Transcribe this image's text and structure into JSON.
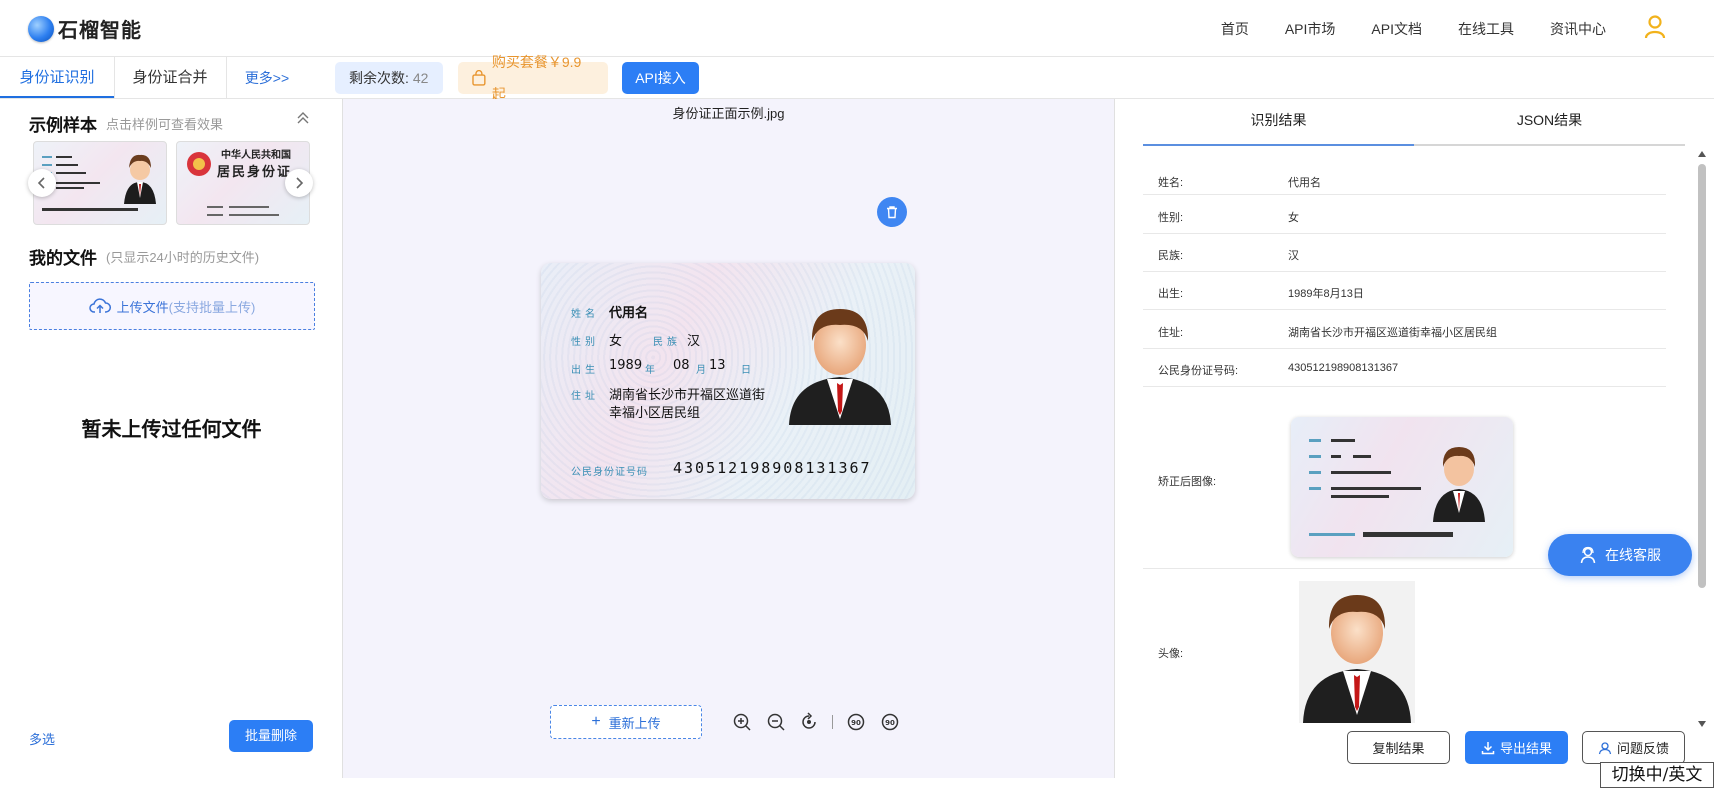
{
  "header": {
    "logo_text": "石榴智能",
    "nav": [
      "首页",
      "API市场",
      "API文档",
      "在线工具",
      "资讯中心"
    ]
  },
  "subbar": {
    "tabs": [
      "身份证识别",
      "身份证合并",
      "更多>>"
    ],
    "remaining_label": "剩余次数:",
    "remaining_count": "42",
    "buy_label": "购买套餐￥9.9起",
    "api_label": "API接入"
  },
  "left": {
    "samples_title": "示例样本",
    "samples_hint": "点击样例可查看效果",
    "files_title": "我的文件",
    "files_hint": "(只显示24小时的历史文件)",
    "upload_label": "上传文件",
    "upload_sub": "(支持批量上传)",
    "empty_text": "暂未上传过任何文件",
    "multi_select": "多选",
    "bulk_delete": "批量删除",
    "sample2_line1": "中华人民共和国",
    "sample2_line2": "居民身份证"
  },
  "center": {
    "file_name": "身份证正面示例.jpg",
    "reupload_label": "重新上传",
    "card": {
      "name_label": "姓名",
      "name": "代用名",
      "gender_label": "性别",
      "gender": "女",
      "ethnicity_label": "民族",
      "ethnicity": "汉",
      "birth_label": "出生",
      "birth_year": "1989",
      "birth_year_unit": "年",
      "birth_month": "08",
      "birth_month_unit": "月",
      "birth_day": "13",
      "birth_day_unit": "日",
      "address_label": "住址",
      "address_line1": "湖南省长沙市开福区巡道街",
      "address_line2": "幸福小区居民组",
      "id_label": "公民身份证号码",
      "id_number": "430512198908131367"
    }
  },
  "right": {
    "tabs": [
      "识别结果",
      "JSON结果"
    ],
    "fields": [
      {
        "label": "姓名:",
        "value": "代用名"
      },
      {
        "label": "性别:",
        "value": "女"
      },
      {
        "label": "民族:",
        "value": "汉"
      },
      {
        "label": "出生:",
        "value": "1989年8月13日"
      },
      {
        "label": "住址:",
        "value": "湖南省长沙市开福区巡道街幸福小区居民组"
      },
      {
        "label": "公民身份证号码:",
        "value": "430512198908131367"
      }
    ],
    "corrected_label": "矫正后图像:",
    "avatar_label": "头像:",
    "copy_btn": "复制结果",
    "export_btn": "导出结果",
    "feedback_btn": "问题反馈",
    "service_btn": "在线客服"
  },
  "ime_indicator": "切换中/英文",
  "colors": {
    "accent": "#2c7ef5",
    "buy_text": "#e8952e",
    "center_bg": "#f4f3fc"
  }
}
